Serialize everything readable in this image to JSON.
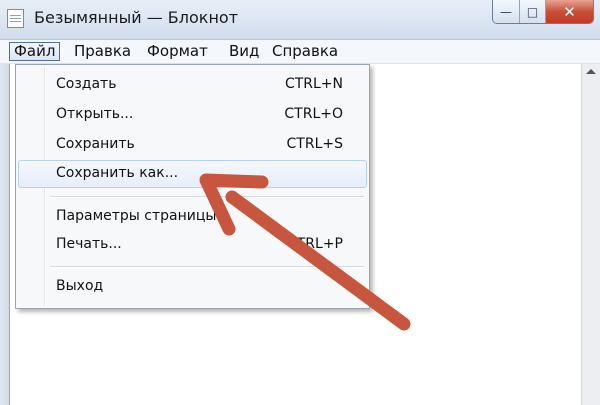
{
  "window": {
    "title": "Безымянный — Блокнот",
    "minimize_glyph": "—",
    "maximize_glyph": "□",
    "close_glyph": "✕"
  },
  "menubar": {
    "items": [
      "Файл",
      "Правка",
      "Формат",
      "Вид",
      "Справка"
    ],
    "active": "Файл"
  },
  "file_menu": {
    "items": [
      {
        "label": "Создать",
        "shortcut": "CTRL+N"
      },
      {
        "label": "Открыть...",
        "shortcut": "CTRL+O"
      },
      {
        "label": "Сохранить",
        "shortcut": "CTRL+S"
      },
      {
        "label": "Сохранить как...",
        "shortcut": ""
      },
      {
        "label": "Параметры страницы...",
        "shortcut": ""
      },
      {
        "label": "Печать...",
        "shortcut": "CTRL+P"
      },
      {
        "label": "Выход",
        "shortcut": ""
      }
    ],
    "highlighted": "Сохранить как..."
  },
  "annotation": {
    "icon": "arrow-icon",
    "color": "#c8553d"
  }
}
